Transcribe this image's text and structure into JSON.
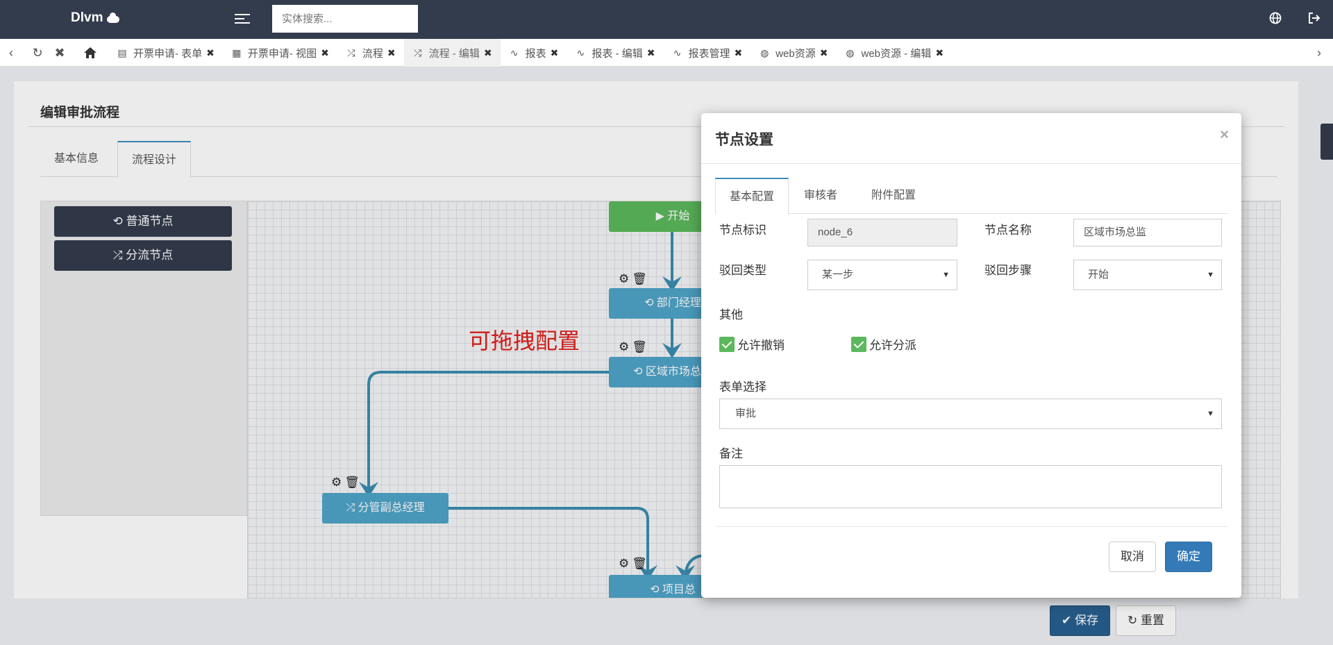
{
  "app": {
    "brand": "Dlvm"
  },
  "header": {
    "search_placeholder": "实体搜索..."
  },
  "tabs": [
    {
      "label": "开票申请- 表单",
      "icon": "form-icon"
    },
    {
      "label": "开票申请- 视图",
      "icon": "view-icon"
    },
    {
      "label": "流程",
      "icon": "flow-icon"
    },
    {
      "label": "流程 - 编辑",
      "icon": "flow-icon",
      "active": true
    },
    {
      "label": "报表",
      "icon": "pulse-icon"
    },
    {
      "label": "报表 - 编辑",
      "icon": "pulse-icon"
    },
    {
      "label": "报表管理",
      "icon": "pulse-icon"
    },
    {
      "label": "web资源",
      "icon": "globe-icon"
    },
    {
      "label": "web资源 - 编辑",
      "icon": "globe-icon"
    }
  ],
  "page": {
    "title": "编辑审批流程",
    "tabs": [
      "基本信息",
      "流程设计"
    ],
    "palette": {
      "normal_node": "普通节点",
      "branch_node": "分流节点"
    },
    "drag_hint": "可拖拽配置",
    "nodes": {
      "start": "开始",
      "dept_manager": "部门经理",
      "regional_director": "区域市场总监",
      "vp": "分管副总经理",
      "project_lead": "项目总"
    },
    "actions": {
      "save": "保存",
      "reset": "重置"
    }
  },
  "modal": {
    "title": "节点设置",
    "tabs": [
      "基本配置",
      "审核者",
      "附件配置"
    ],
    "node_id_label": "节点标识",
    "node_id_value": "node_6",
    "node_name_label": "节点名称",
    "node_name_value": "区域市场总监",
    "reject_type_label": "驳回类型",
    "reject_type_value": "某一步",
    "reject_step_label": "驳回步骤",
    "reject_step_value": "开始",
    "other_label": "其他",
    "allow_revoke": "允许撤销",
    "allow_assign": "允许分派",
    "form_select_label": "表单选择",
    "form_select_value": "审批",
    "remark_label": "备注",
    "remark_value": "",
    "cancel": "取消",
    "confirm": "确定"
  },
  "colors": {
    "topbar": "#333c4d",
    "node": "#4fa3c8",
    "start": "#5cb85c",
    "primary": "#337ab7",
    "hint": "#e0201d"
  }
}
